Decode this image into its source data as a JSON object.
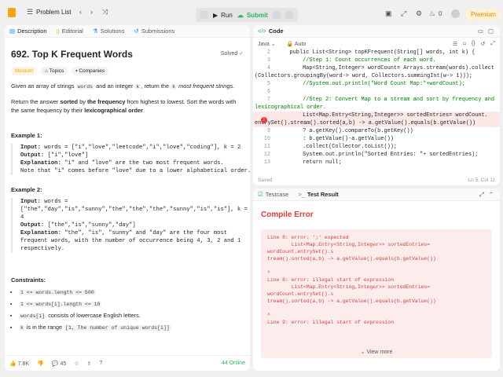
{
  "topbar": {
    "title": "Problem List",
    "run_label": "Run",
    "submit_label": "Submit",
    "notifications": "0",
    "premium_label": "Premium"
  },
  "left_tabs": [
    "Description",
    "Editorial",
    "Solutions",
    "Submissions"
  ],
  "problem": {
    "title": "692. Top K Frequent Words",
    "solved": "Solved",
    "difficulty": "Medium",
    "topics": "Topics",
    "companies": "Companies",
    "desc_1a": "Given an array of strings ",
    "desc_1b": "words",
    "desc_1c": " and an integer ",
    "desc_1d": "k",
    "desc_1e": ", return the ",
    "desc_1f": "k",
    "desc_1g": " most frequent strings",
    "desc_1h": ".",
    "desc_2a": "Return the answer ",
    "desc_2b": "sorted",
    "desc_2c": " by ",
    "desc_2d": "the frequency",
    "desc_2e": " from highest to lowest. Sort the words with the same frequency by their ",
    "desc_2f": "lexicographical order",
    "desc_2g": ".",
    "ex1_heading": "Example 1:",
    "ex1_input_label": "Input:",
    "ex1_input": " words = [\"i\",\"love\",\"leetcode\",\"i\",\"love\",\"coding\"], k = 2",
    "ex1_output_label": "Output:",
    "ex1_output": " [\"i\",\"love\"]",
    "ex1_expl_label": "Explanation:",
    "ex1_expl": " \"i\" and \"love\" are the two most frequent words.\nNote that \"i\" comes before \"love\" due to a lower alphabetical order.",
    "ex2_heading": "Example 2:",
    "ex2_input_label": "Input:",
    "ex2_input": " words =\n[\"the\",\"day\",\"is\",\"sunny\",\"the\",\"the\",\"the\",\"sunny\",\"is\",\"is\"], k =\n4",
    "ex2_output_label": "Output:",
    "ex2_output": " [\"the\",\"is\",\"sunny\",\"day\"]",
    "ex2_expl_label": "Explanation:",
    "ex2_expl": " \"the\", \"is\", \"sunny\" and \"day\" are the four most\nfrequent words, with the number of occurrence being 4, 3, 2 and 1\nrespectively.",
    "constraints_heading": "Constraints:",
    "c1": "1 <= words.length <= 500",
    "c2": "1 <= words[i].length <= 10",
    "c3_code": "words[i]",
    "c3_text": " consists of lowercase English letters.",
    "c4_pre": "k",
    "c4_mid": " is in the range ",
    "c4_code": "[1, The number of unique words[i]]"
  },
  "footer": {
    "likes": "7.8K",
    "comments": "45",
    "online": "44 Online"
  },
  "code_panel": {
    "tab": "Code",
    "language": "Java",
    "auto": "Auto",
    "saved": "Saved",
    "cursor": "Ln 5, Col 11",
    "lines": [
      {
        "n": "2",
        "t": "    public List<String> topKFrequent(String[] words, int k) {"
      },
      {
        "n": "3",
        "t": "        //Step 1: Count occurrences of each word."
      },
      {
        "n": "4",
        "t": "        Map<String,Integer> wordCount= Arrays.stream(words).collect"
      },
      {
        "n": "",
        "t": "(Collectors.groupingBy(word-> word, Collectors.summingInt(w-> 1)));"
      },
      {
        "n": "5",
        "t": "        //System.out.println(\"Word Count Map:\"+wordCount);"
      },
      {
        "n": "6",
        "t": ""
      },
      {
        "n": "7",
        "t": "        //Step 2: Convert Map to a stream and sort by frequency and"
      },
      {
        "n": "",
        "t": "lexicographical order."
      },
      {
        "n": "",
        "t": "        List<Map.Entry<String,Integer>> sortedEntries= wordCount."
      },
      {
        "n": "",
        "t": "entrySet().stream().sorted(a,b) -> a.getValue().equals(b.getValue())"
      },
      {
        "n": "9",
        "t": "        ? a.getKey().compareTo(b.getKey())"
      },
      {
        "n": "10",
        "t": "        : b.getValue()-a.getValue())"
      },
      {
        "n": "11",
        "t": "        .collect(Collector.toList());"
      },
      {
        "n": "12",
        "t": "        System.out.println(\"Sorted Entries: \"+ sortedEntries);"
      },
      {
        "n": "13",
        "t": "        return null;"
      }
    ]
  },
  "result_panel": {
    "tab_testcase": "Testcase",
    "tab_result": "Test Result",
    "heading": "Compile Error",
    "error_text": "Line 8: error: ';' expected\n        List<Map.Entry<String,Integer>> sortedEntries= wordCount.entrySet().s\ntream().sorted(a,b) -> a.getValue().equals(b.getValue())\n\n^\nLine 8: error: illegal start of expression\n        List<Map.Entry<String,Integer>> sortedEntries= wordCount.entrySet().s\ntream().sorted(a,b) -> a.getValue().equals(b.getValue())\n\n^\nLine 9: error: illegal start of expression",
    "view_more": "View more"
  }
}
